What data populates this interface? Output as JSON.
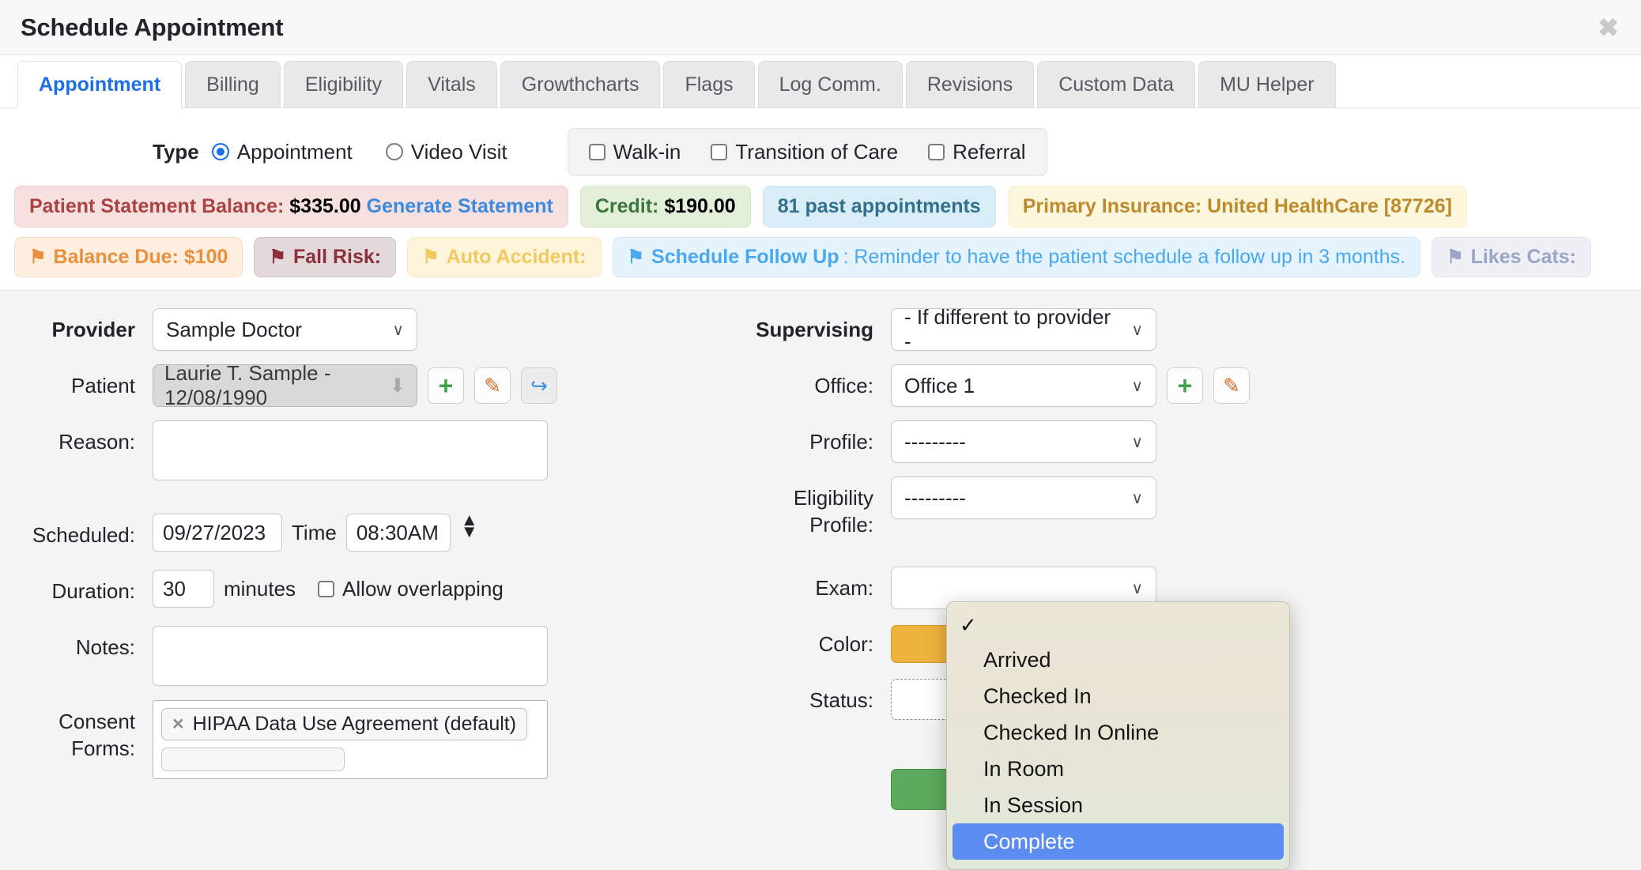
{
  "window": {
    "title": "Schedule Appointment",
    "close_icon": "close-icon",
    "close_glyph": "✖"
  },
  "tabs": [
    {
      "label": "Appointment",
      "active": true
    },
    {
      "label": "Billing",
      "active": false
    },
    {
      "label": "Eligibility",
      "active": false
    },
    {
      "label": "Vitals",
      "active": false
    },
    {
      "label": "Growthcharts",
      "active": false
    },
    {
      "label": "Flags",
      "active": false
    },
    {
      "label": "Log Comm.",
      "active": false
    },
    {
      "label": "Revisions",
      "active": false
    },
    {
      "label": "Custom Data",
      "active": false
    },
    {
      "label": "MU Helper",
      "active": false
    }
  ],
  "type_row": {
    "label": "Type",
    "radios": [
      {
        "label": "Appointment",
        "checked": true
      },
      {
        "label": "Video Visit",
        "checked": false
      }
    ],
    "checkboxes": [
      {
        "label": "Walk-in",
        "checked": false
      },
      {
        "label": "Transition of Care",
        "checked": false
      },
      {
        "label": "Referral",
        "checked": false
      }
    ]
  },
  "badges": {
    "statement_label": "Patient Statement Balance:",
    "statement_amount": "$335.00",
    "statement_link": "Generate Statement",
    "credit_label": "Credit:",
    "credit_amount": "$190.00",
    "past_appointments": "81 past appointments",
    "primary_insurance": "Primary Insurance: United HealthCare [87726]"
  },
  "flags": [
    {
      "icon": "flag-icon",
      "label": "Balance Due: $100",
      "desc": ""
    },
    {
      "icon": "flag-icon",
      "label": "Fall Risk:",
      "desc": ""
    },
    {
      "icon": "flag-icon",
      "label": "Auto Accident:",
      "desc": ""
    },
    {
      "icon": "flag-icon",
      "label": "Schedule Follow Up",
      "desc": ": Reminder to have the patient schedule a follow up in 3 months."
    },
    {
      "icon": "flag-icon",
      "label": "Likes Cats:",
      "desc": ""
    }
  ],
  "form": {
    "provider_label": "Provider",
    "provider_value": "Sample Doctor",
    "patient_label": "Patient",
    "patient_value": "Laurie T. Sample - 12/08/1990",
    "patient_add_icon": "plus-icon",
    "patient_edit_icon": "pencil-icon",
    "patient_share_icon": "share-icon",
    "reason_label": "Reason:",
    "reason_value": "",
    "scheduled_label": "Scheduled:",
    "scheduled_date": "09/27/2023",
    "time_label": "Time",
    "time_value": "08:30AM",
    "spinner_icon": "spinner-up-down-icon",
    "duration_label": "Duration:",
    "duration_value": "30",
    "minutes_label": "minutes",
    "allow_overlapping_label": "Allow overlapping",
    "allow_overlapping_checked": false,
    "notes_label": "Notes:",
    "notes_value": "",
    "consent_label": "Consent Forms:",
    "consent_chip": "HIPAA Data Use Agreement (default)",
    "consent_chip_remove": "×",
    "supervising_label": "Supervising",
    "supervising_value": "- If different to provider -",
    "office_label": "Office:",
    "office_value": "Office 1",
    "office_add_icon": "plus-icon",
    "office_edit_icon": "pencil-icon",
    "profile_label": "Profile:",
    "profile_value": "---------",
    "eligibility_profile_label": "Eligibility Profile:",
    "eligibility_profile_value": "---------",
    "exam_label": "Exam:",
    "exam_value": "",
    "color_label": "Color:",
    "color_value": "#eeb33c",
    "status_label": "Status:",
    "status_value": ""
  },
  "dropdown": {
    "options": [
      {
        "label": "✓",
        "is_check": true,
        "selected": false
      },
      {
        "label": "Arrived",
        "is_check": false,
        "selected": false
      },
      {
        "label": "Checked In",
        "is_check": false,
        "selected": false
      },
      {
        "label": "Checked In Online",
        "is_check": false,
        "selected": false
      },
      {
        "label": "In Room",
        "is_check": false,
        "selected": false
      },
      {
        "label": "In Session",
        "is_check": false,
        "selected": false
      },
      {
        "label": "Complete",
        "is_check": false,
        "selected": true
      }
    ]
  },
  "colors": {
    "accent": "#1a6fe8",
    "selection": "#5b8cf0",
    "danger": "#a94442",
    "success": "#3c763d",
    "info": "#31708f",
    "warning": "#bd8a2c"
  }
}
